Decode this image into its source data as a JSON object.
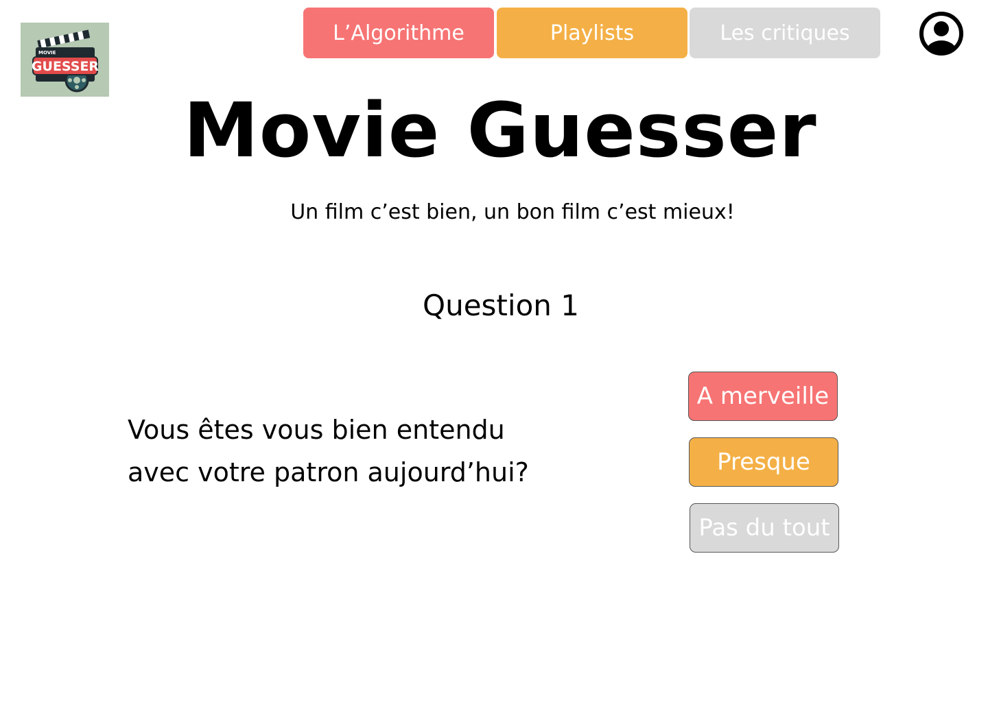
{
  "logo": {
    "small_text": "MOVIE",
    "brand_text": "GUESSER",
    "background_color": "#b5c9b3",
    "icon": "movie-clapper-logo"
  },
  "nav": {
    "tabs": [
      {
        "label": "L’Algorithme",
        "color": "#f77474"
      },
      {
        "label": "Playlists",
        "color": "#f4b046"
      },
      {
        "label": "Les critiques",
        "color": "#d9d9d9"
      }
    ],
    "profile_icon": "user-circle-icon"
  },
  "header": {
    "title": "Movie Guesser",
    "tagline": "Un film c’est bien, un bon film c’est mieux!"
  },
  "quiz": {
    "question_label": "Question 1",
    "question_line1": "Vous êtes vous bien entendu",
    "question_line2": "avec votre patron aujourd’hui?",
    "answers": [
      {
        "label": "A merveille",
        "color": "#f77474"
      },
      {
        "label": "Presque",
        "color": "#f4b046"
      },
      {
        "label": "Pas du tout",
        "color": "#d9d9d9"
      }
    ]
  }
}
